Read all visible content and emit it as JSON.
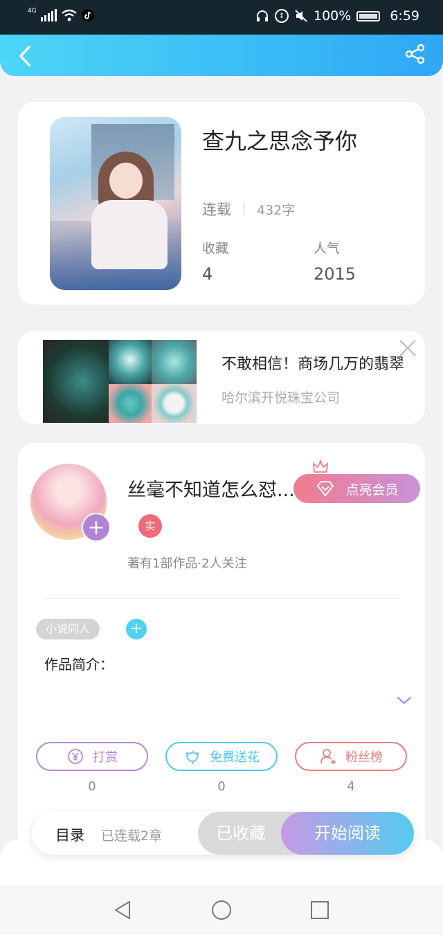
{
  "status_bar": {
    "network": "4G",
    "battery": "100%",
    "time": "6:59"
  },
  "book": {
    "title": "查九之思念予你",
    "status": "连载",
    "word_count": "432字",
    "favorites_label": "收藏",
    "favorites_value": "4",
    "popularity_label": "人气",
    "popularity_value": "2015"
  },
  "ad": {
    "title": "不敢相信！商场几万的翡翠",
    "advertiser": "哈尔滨开悦珠宝公司"
  },
  "author": {
    "name": "丝毫不知道怎么怼...",
    "vip_button": "点亮会员",
    "real_badge": "实",
    "meta": "著有1部作品·2人关注",
    "tag": "小说同人",
    "intro_label": "作品简介："
  },
  "actions": {
    "tip_label": "打赏",
    "tip_count": "0",
    "flower_label": "免费送花",
    "flower_count": "0",
    "fans_label": "粉丝榜",
    "fans_count": "4",
    "tip_color": "#b786dc",
    "flower_color": "#4cc9ee",
    "fans_color": "#ec7d7d"
  },
  "bottom_bar": {
    "toc_label": "目录",
    "chapters_label": "已连载2章",
    "collected_label": "已收藏",
    "start_label": "开始阅读"
  }
}
